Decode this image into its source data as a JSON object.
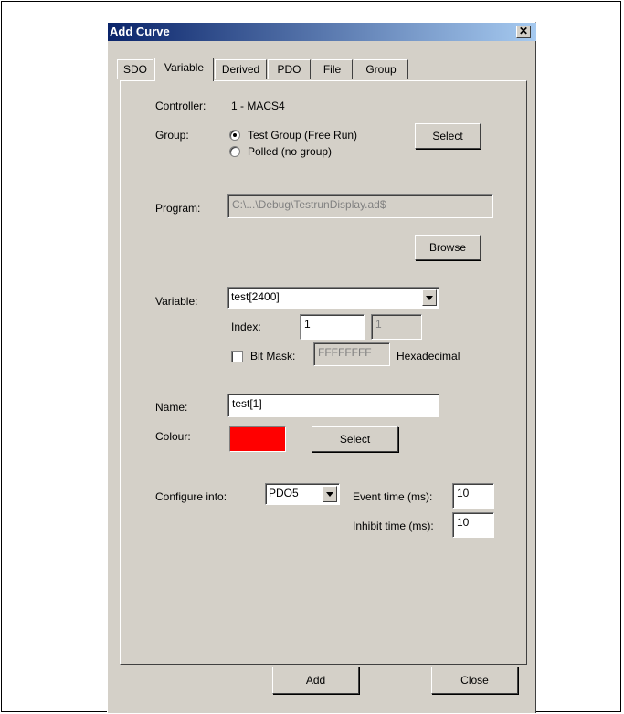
{
  "window": {
    "title": "Add Curve",
    "close_glyph": "✕"
  },
  "tabs": [
    "SDO",
    "Variable",
    "Derived",
    "PDO",
    "File",
    "Group"
  ],
  "controller": {
    "label": "Controller:",
    "value": "1 - MACS4"
  },
  "group": {
    "label": "Group:",
    "options": [
      "Test Group (Free Run)",
      "Polled (no group)"
    ],
    "selected": "Test Group (Free Run)",
    "select_button": "Select"
  },
  "program": {
    "label": "Program:",
    "value": "C:\\...\\Debug\\TestrunDisplay.ad$",
    "browse_button": "Browse"
  },
  "variable": {
    "label": "Variable:",
    "value": "test[2400]",
    "index_label": "Index:",
    "index_value": "1",
    "index_value_disabled": "1",
    "bitmask_label": "Bit Mask:",
    "bitmask_checked": false,
    "bitmask_value": "FFFFFFFF",
    "hex_label": "Hexadecimal"
  },
  "name": {
    "label": "Name:",
    "value": "test[1]"
  },
  "colour": {
    "label": "Colour:",
    "value": "#ff0000",
    "select_button": "Select"
  },
  "configure": {
    "label": "Configure into:",
    "value": "PDO5",
    "event_label": "Event time (ms):",
    "event_value": "10",
    "inhibit_label": "Inhibit time (ms):",
    "inhibit_value": "10"
  },
  "footer": {
    "add_button": "Add",
    "close_button": "Close"
  }
}
